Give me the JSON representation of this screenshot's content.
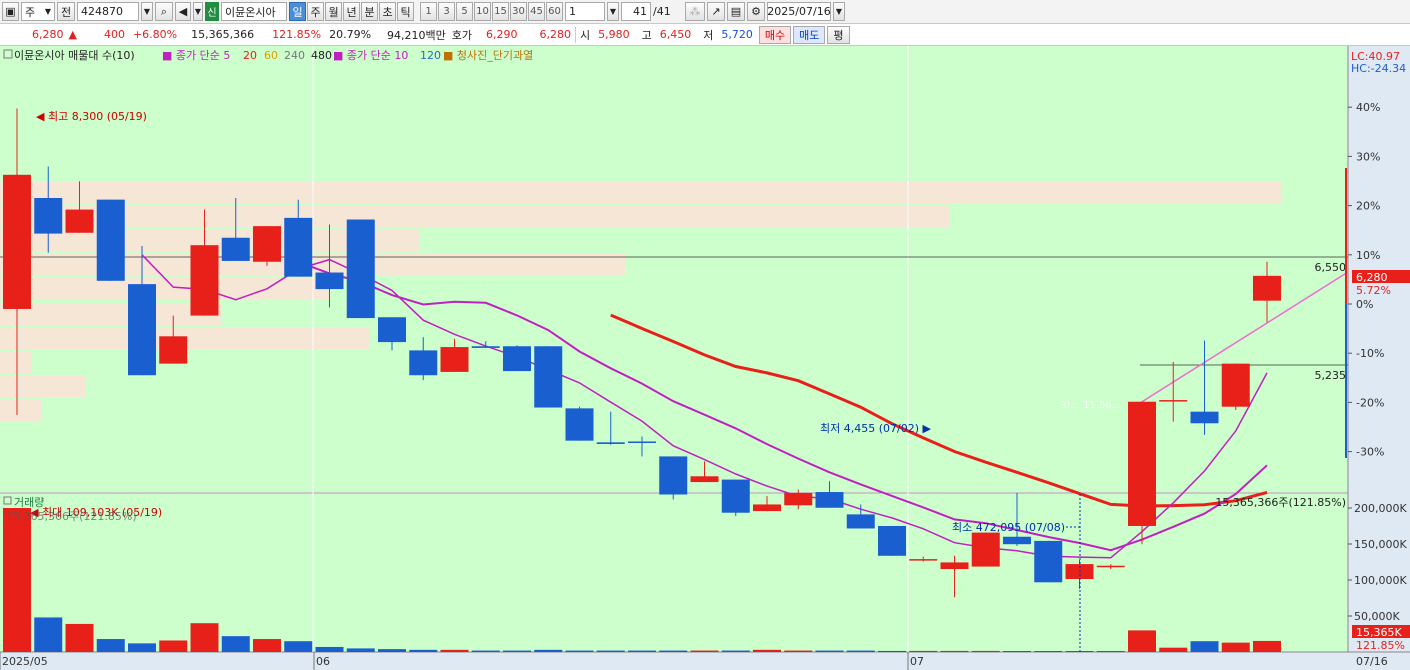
{
  "toolbar": {
    "market": "주",
    "prev_label": "전",
    "code": "424870",
    "new_badge": "신",
    "stock_name": "이뮨온시아",
    "periods": [
      "일",
      "주",
      "월",
      "년",
      "분",
      "초",
      "틱"
    ],
    "active_period": "일",
    "numbers": [
      "1",
      "3",
      "5",
      "10",
      "15",
      "30",
      "45",
      "60"
    ],
    "count_value": "1",
    "page": "41",
    "page_total": "/41",
    "date": "2025/07/16"
  },
  "quote": {
    "price": "6,280",
    "change_arrow": "▲",
    "change": "400",
    "change_pct": "+6.80%",
    "volume": "15,365,366",
    "volume_pct": "121.85%",
    "turnover": "20.79%",
    "amount": "94,210백만",
    "hoga_label": "호가",
    "ask": "6,290",
    "bid": "6,280",
    "open_label": "시",
    "open": "5,980",
    "high_label": "고",
    "high": "6,450",
    "low_label": "저",
    "low": "5,720",
    "buy_label": "매수",
    "sell_label": "매도",
    "eval_label": "평"
  },
  "legend": {
    "name": "이뮨온시아 매물대 수(10)",
    "ma1_label": "종가 단순 5",
    "ma1_periods": [
      "20",
      "60",
      "240",
      "480"
    ],
    "ma2_label": "종가 단순 10",
    "ma2_period": "120",
    "signal_label": "청사진_단기과열"
  },
  "price_panel": {
    "lc": "LC:40.97",
    "hc": "HC:-24.34",
    "y_ticks": [
      "40%",
      "30%",
      "20%",
      "10%",
      "0%",
      "-10%",
      "-20%",
      "-30%"
    ],
    "max_annotation": "최고 8,300 (05/19)",
    "min_annotation": "최저 4,455 (07/02)",
    "level_high": "6,550",
    "level_low": "5,235",
    "current_price": "6,280",
    "current_pct": "5.72%",
    "overlay_text": "3!... 11,56..."
  },
  "volume_panel": {
    "title": "거래량",
    "max_annotation": "최대 109,103K (05/19)",
    "first_value": "15,365,366주(121.85%)",
    "right_value": "15,365,366주(121.85%)",
    "min_annotation": "최소 472,095 (07/08)",
    "y_ticks": [
      "200,000K",
      "150,000K",
      "100,000K",
      "50,000K"
    ],
    "current_volume": "15,365K",
    "current_pct": "121.85%"
  },
  "x_axis": {
    "labels": [
      "2025/05",
      "06",
      "07"
    ],
    "right_label": "07/16"
  },
  "colors": {
    "up": "#e8201a",
    "down": "#1a5fd0",
    "bg": "#ccffcc",
    "volume_profile": "#f6e6d6",
    "ma_red": "#e8201a",
    "ma_magenta": "#c020c0",
    "ma_pink": "#f06ad0"
  },
  "chart_data": {
    "type": "candlestick",
    "series": [
      {
        "o": 5880,
        "h": 8300,
        "l": 4600,
        "c": 7500
      },
      {
        "o": 7220,
        "h": 7600,
        "l": 6560,
        "c": 6790
      },
      {
        "o": 6800,
        "h": 7420,
        "l": 6880,
        "c": 7080
      },
      {
        "o": 7200,
        "h": 7200,
        "l": 6380,
        "c": 6220
      },
      {
        "o": 6180,
        "h": 6640,
        "l": 5080,
        "c": 5080
      },
      {
        "o": 5220,
        "h": 5800,
        "l": 5420,
        "c": 5550
      },
      {
        "o": 5800,
        "h": 7080,
        "l": 5880,
        "c": 6650
      },
      {
        "o": 6740,
        "h": 7220,
        "l": 6700,
        "c": 6460
      },
      {
        "o": 6450,
        "h": 6860,
        "l": 6400,
        "c": 6880
      },
      {
        "o": 6980,
        "h": 7200,
        "l": 6950,
        "c": 6270
      },
      {
        "o": 6320,
        "h": 6900,
        "l": 5900,
        "c": 6120
      },
      {
        "o": 6960,
        "h": 6960,
        "l": 5800,
        "c": 5770
      },
      {
        "o": 5780,
        "h": 5780,
        "l": 5380,
        "c": 5480
      },
      {
        "o": 5380,
        "h": 5540,
        "l": 5020,
        "c": 5080
      },
      {
        "o": 5120,
        "h": 5520,
        "l": 5180,
        "c": 5420
      },
      {
        "o": 5430,
        "h": 5490,
        "l": 5430,
        "c": 5410
      },
      {
        "o": 5430,
        "h": 5440,
        "l": 5130,
        "c": 5130
      },
      {
        "o": 5430,
        "h": 5430,
        "l": 4800,
        "c": 4690
      },
      {
        "o": 4680,
        "h": 4700,
        "l": 4500,
        "c": 4290
      },
      {
        "o": 4270,
        "h": 4640,
        "l": 4240,
        "c": 4250
      },
      {
        "o": 4280,
        "h": 4340,
        "l": 4100,
        "c": 4270
      },
      {
        "o": 4100,
        "h": 4100,
        "l": 3580,
        "c": 3640
      },
      {
        "o": 3790,
        "h": 4040,
        "l": 3790,
        "c": 3860
      },
      {
        "o": 3820,
        "h": 3820,
        "l": 3380,
        "c": 3420
      },
      {
        "o": 3440,
        "h": 3620,
        "l": 3440,
        "c": 3520
      },
      {
        "o": 3510,
        "h": 3700,
        "l": 3460,
        "c": 3660
      },
      {
        "o": 3670,
        "h": 3800,
        "l": 3800,
        "c": 3480
      },
      {
        "o": 3400,
        "h": 3520,
        "l": 3250,
        "c": 3230
      },
      {
        "o": 3260,
        "h": 3260,
        "l": 2950,
        "c": 2900
      },
      {
        "o": 2860,
        "h": 2890,
        "l": 2830,
        "c": 2860
      },
      {
        "o": 2740,
        "h": 2900,
        "l": 2400,
        "c": 2820
      },
      {
        "o": 2770,
        "h": 3180,
        "l": 2780,
        "c": 3180
      },
      {
        "o": 3130,
        "h": 3660,
        "l": 3020,
        "c": 3040
      },
      {
        "o": 3080,
        "h": 3080,
        "l": 2580,
        "c": 2580
      },
      {
        "o": 2620,
        "h": 2850,
        "l": 2500,
        "c": 2800
      },
      {
        "o": 2780,
        "h": 2800,
        "l": 2740,
        "c": 2780
      },
      {
        "o": 3260,
        "h": 4120,
        "l": 3040,
        "c": 4760
      },
      {
        "o": 4780,
        "h": 5240,
        "l": 4520,
        "c": 4780
      },
      {
        "o": 4640,
        "h": 5500,
        "l": 4360,
        "c": 4500
      },
      {
        "o": 4700,
        "h": 5100,
        "l": 4660,
        "c": 5220
      },
      {
        "o": 5980,
        "h": 6450,
        "l": 5720,
        "c": 6280
      }
    ],
    "volume_k": [
      200000,
      48000,
      39000,
      18000,
      12000,
      16000,
      40000,
      22000,
      18000,
      15000,
      7000,
      5000,
      4000,
      3000,
      3000,
      2000,
      2000,
      3000,
      2000,
      2000,
      2000,
      2000,
      2000,
      2000,
      3000,
      2000,
      2000,
      2000,
      1500,
      1500,
      1500,
      1500,
      1000,
      1000,
      900,
      472,
      30000,
      6000,
      15000,
      13000,
      15365
    ],
    "y_ticks_pct": [
      40,
      30,
      20,
      10,
      0,
      -10,
      -20,
      -30
    ],
    "x_labels": [
      "2025/05",
      "06",
      "07"
    ]
  }
}
